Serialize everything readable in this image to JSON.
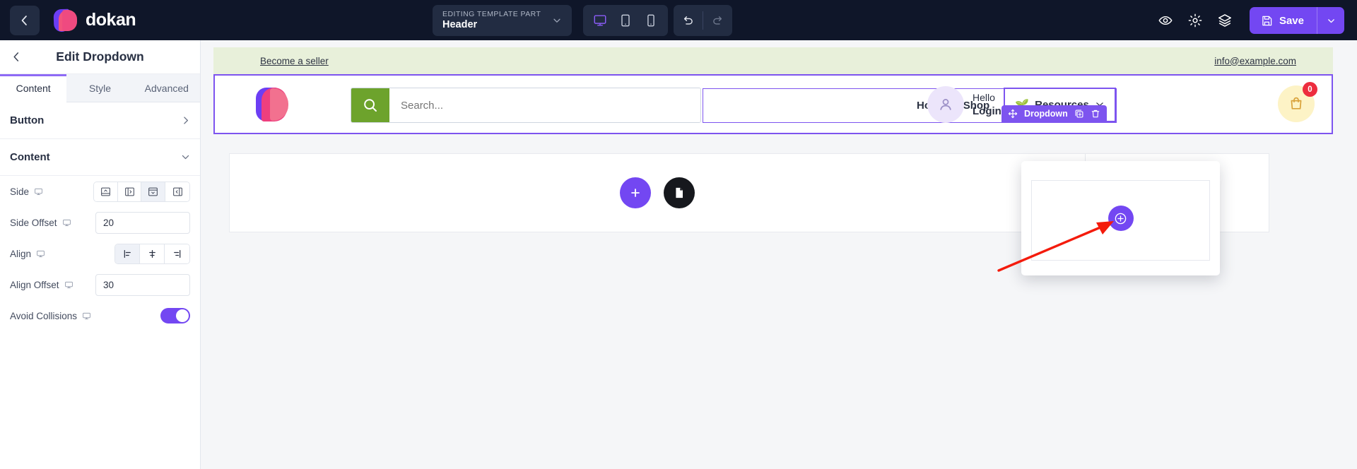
{
  "topbar": {
    "back_icon": "chevron-left-icon",
    "brand": "dokan",
    "template_pill": {
      "eyebrow": "EDITING TEMPLATE PART",
      "title": "Header",
      "caret_icon": "chevron-down-icon"
    },
    "devices": [
      {
        "name": "desktop",
        "icon": "monitor-icon",
        "active": true
      },
      {
        "name": "tablet",
        "icon": "tablet-icon",
        "active": false
      },
      {
        "name": "mobile",
        "icon": "mobile-icon",
        "active": false
      }
    ],
    "history": [
      {
        "name": "undo",
        "icon": "undo-icon",
        "enabled": true
      },
      {
        "name": "redo",
        "icon": "redo-icon",
        "enabled": false
      }
    ],
    "tools": [
      {
        "name": "preview",
        "icon": "eye-icon"
      },
      {
        "name": "settings",
        "icon": "gear-icon"
      },
      {
        "name": "layers",
        "icon": "layers-icon"
      }
    ],
    "save_label": "Save",
    "save_icon": "floppy-disk-icon",
    "save_caret_icon": "chevron-down-icon",
    "accent_purple": "#7347f2",
    "bar_background": "#0f1629"
  },
  "panel": {
    "back_icon": "chevron-left-icon",
    "title": "Edit Dropdown",
    "tabs": [
      {
        "label": "Content",
        "active": true
      },
      {
        "label": "Style",
        "active": false
      },
      {
        "label": "Advanced",
        "active": false
      }
    ],
    "sections": [
      {
        "label": "Button",
        "chevron": "chevron-right-icon",
        "expanded": false
      },
      {
        "label": "Content",
        "chevron": "chevron-down-icon",
        "expanded": true
      }
    ],
    "controls": {
      "side": {
        "label": "Side",
        "responsive_icon": "monitor-icon",
        "options": [
          {
            "name": "side-top",
            "icon": "panel-top-icon",
            "selected": false
          },
          {
            "name": "side-right",
            "icon": "panel-right-icon",
            "selected": false
          },
          {
            "name": "side-bottom",
            "icon": "panel-bottom-icon",
            "selected": true
          },
          {
            "name": "side-left",
            "icon": "panel-left-icon",
            "selected": false
          }
        ]
      },
      "side_offset": {
        "label": "Side Offset",
        "responsive_icon": "monitor-icon",
        "value": "20"
      },
      "align": {
        "label": "Align",
        "responsive_icon": "monitor-icon",
        "options": [
          {
            "name": "align-start",
            "icon": "align-start-icon",
            "selected": true
          },
          {
            "name": "align-center",
            "icon": "align-center-icon",
            "selected": false
          },
          {
            "name": "align-end",
            "icon": "align-end-icon",
            "selected": false
          }
        ]
      },
      "align_offset": {
        "label": "Align Offset",
        "responsive_icon": "monitor-icon",
        "value": "30"
      },
      "avoid_collisions": {
        "label": "Avoid Collisions",
        "responsive_icon": "monitor-icon",
        "enabled": true,
        "toggle_color": "#7347f2"
      }
    },
    "collapse_icon": "chevron-left-icon"
  },
  "canvas": {
    "site_topbar": {
      "seller_link": "Become a seller",
      "email": "info@example.com",
      "background": "#e8f0da"
    },
    "site_header": {
      "logo_name": "dokan-logo",
      "search_placeholder": "Search...",
      "search_icon": "search-icon",
      "search_button_color": "#6da32c",
      "nav": [
        {
          "label": "Home"
        },
        {
          "label": "Shop"
        }
      ],
      "resources": {
        "label": "Resources",
        "emoji": "🌱",
        "caret_icon": "chevrons-down-icon",
        "highlight_color": "#7d54ef"
      },
      "account": {
        "avatar_icon": "user-icon",
        "hello": "Hello",
        "login": "Login or Signup"
      },
      "cart": {
        "icon": "shopping-bag-icon",
        "count": "0",
        "badge_color": "#ed2d3e",
        "bg_color": "#fdf3c6"
      }
    },
    "element_badge": {
      "move_icon": "move-icon",
      "label": "Dropdown",
      "duplicate_icon": "duplicate-icon",
      "delete_icon": "trash-icon",
      "color": "#7d54ef"
    },
    "dropdown_popup": {
      "add_icon": "plus-circle-icon",
      "add_color": "#7347f2"
    },
    "page_body": {
      "add_icon": "plus-circle-icon",
      "template_icon": "document-icon"
    },
    "annotation": {
      "arrow_color": "#f41b0c",
      "name": "red-arrow-pointer"
    }
  }
}
